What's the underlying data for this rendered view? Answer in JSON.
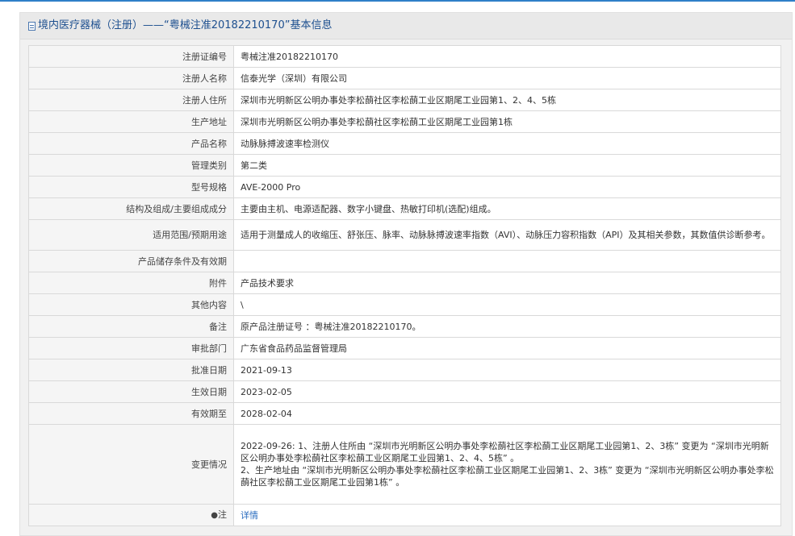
{
  "header": {
    "title": "境内医疗器械（注册）——“粤械注准20182210170”基本信息"
  },
  "rows": [
    {
      "label": "注册证编号",
      "value": "粤械注准20182210170"
    },
    {
      "label": "注册人名称",
      "value": "信泰光学（深圳）有限公司"
    },
    {
      "label": "注册人住所",
      "value": "深圳市光明新区公明办事处李松蓢社区李松蓢工业区期尾工业园第1、2、4、5栋"
    },
    {
      "label": "生产地址",
      "value": "深圳市光明新区公明办事处李松蓢社区李松蓢工业区期尾工业园第1栋"
    },
    {
      "label": "产品名称",
      "value": "动脉脉搏波速率检测仪"
    },
    {
      "label": "管理类别",
      "value": "第二类"
    },
    {
      "label": "型号规格",
      "value": "AVE-2000 Pro"
    },
    {
      "label": "结构及组成/主要组成成分",
      "value": "主要由主机、电源适配器、数字小键盘、热敏打印机(选配)组成。"
    },
    {
      "label": "适用范围/预期用途",
      "value": "适用于测量成人的收缩压、舒张压、脉率、动脉脉搏波速率指数（AVI）、动脉压力容积指数（API）及其相关参数，其数值供诊断参考。"
    },
    {
      "label": "产品储存条件及有效期",
      "value": ""
    },
    {
      "label": "附件",
      "value": "产品技术要求"
    },
    {
      "label": "其他内容",
      "value": "\\"
    },
    {
      "label": "备注",
      "value": "原产品注册证号 ：粤械注准20182210170。"
    },
    {
      "label": "审批部门",
      "value": "广东省食品药品监督管理局"
    },
    {
      "label": "批准日期",
      "value": "2021-09-13"
    },
    {
      "label": "生效日期",
      "value": "2023-02-05"
    },
    {
      "label": "有效期至",
      "value": "2028-02-04"
    }
  ],
  "change": {
    "label": "变更情况",
    "line1": "2022-09-26: 1、注册人住所由 “深圳市光明新区公明办事处李松蓢社区李松蓢工业区期尾工业园第1、2、3栋” 变更为 “深圳市光明新区公明办事处李松蓢社区李松蓢工业区期尾工业园第1、2、4、5栋” 。",
    "line2": "2、生产地址由 “深圳市光明新区公明办事处李松蓢社区李松蓢工业区期尾工业园第1、2、3栋” 变更为 “深圳市光明新区公明办事处李松蓢社区李松蓢工业区期尾工业园第1栋” 。"
  },
  "note": {
    "icon": "pin-icon",
    "label": "注",
    "link": "详情"
  }
}
